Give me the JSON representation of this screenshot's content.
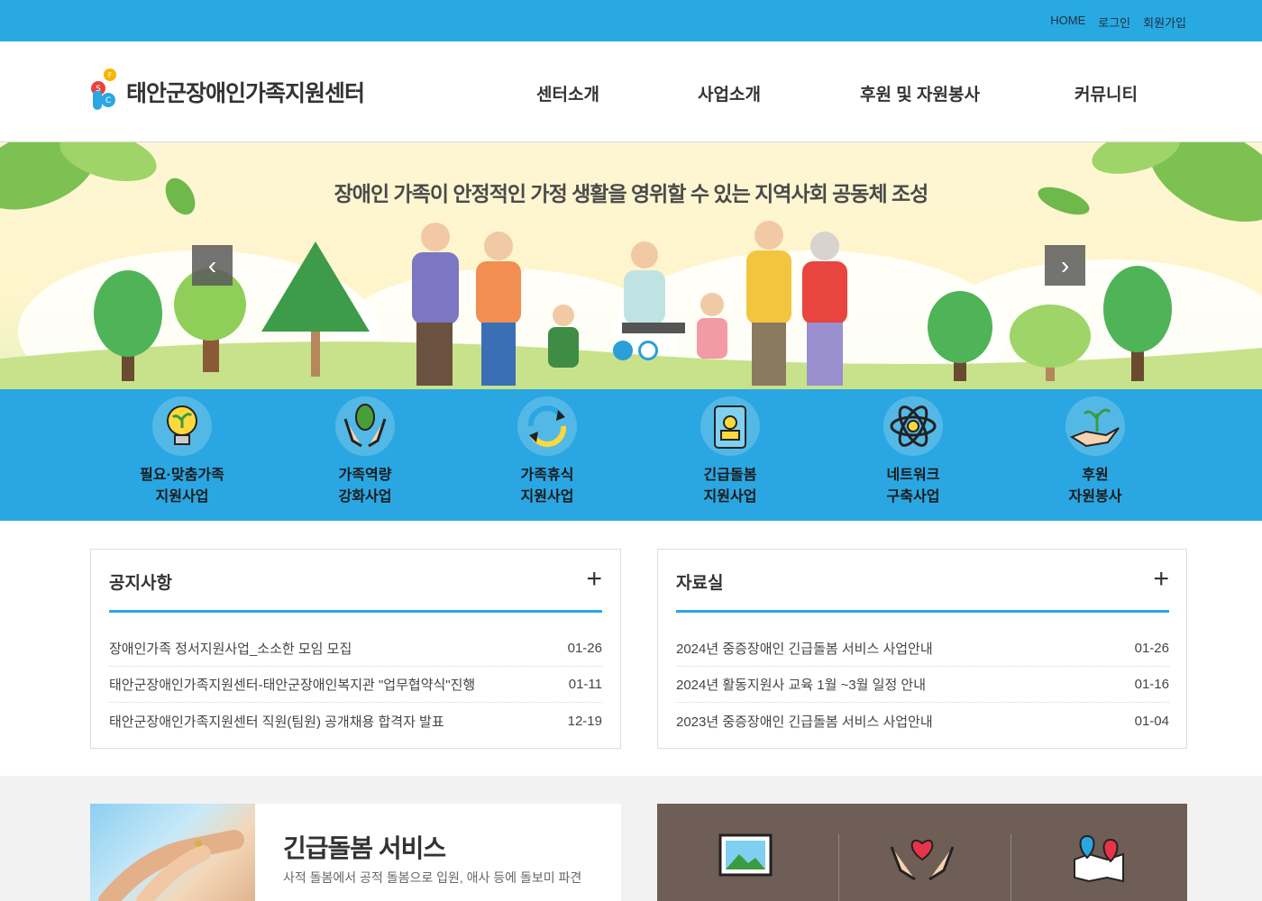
{
  "top_links": [
    "HOME",
    "로그인",
    "회원가입"
  ],
  "site": {
    "name": "태안군장애인가족지원센터"
  },
  "nav": [
    "센터소개",
    "사업소개",
    "후원 및 자원봉사",
    "커뮤니티"
  ],
  "hero": {
    "title": "장애인 가족이 안정적인 가정 생활을 영위할 수 있는 지역사회 공동체 조성"
  },
  "quick_services": [
    {
      "line1": "필요·맞춤가족",
      "line2": "지원사업",
      "icon": "lightbulb-sprout-icon"
    },
    {
      "line1": "가족역량",
      "line2": "강화사업",
      "icon": "hands-leaf-icon"
    },
    {
      "line1": "가족휴식",
      "line2": "지원사업",
      "icon": "refresh-arrows-icon"
    },
    {
      "line1": "긴급돌봄",
      "line2": "지원사업",
      "icon": "id-badge-icon"
    },
    {
      "line1": "네트워크",
      "line2": "구축사업",
      "icon": "atom-network-icon"
    },
    {
      "line1": "후원",
      "line2": "자원봉사",
      "icon": "hand-plant-icon"
    }
  ],
  "notice": {
    "title": "공지사항",
    "items": [
      {
        "text": "장애인가족 정서지원사업_소소한 모임 모집",
        "date": "01-26"
      },
      {
        "text": "태안군장애인가족지원센터-태안군장애인복지관 \"업무협약식\"진행",
        "date": "01-11"
      },
      {
        "text": "태안군장애인가족지원센터 직원(팀원) 공개채용 합격자 발표",
        "date": "12-19"
      }
    ]
  },
  "archive": {
    "title": "자료실",
    "items": [
      {
        "text": "2024년 중증장애인 긴급돌봄 서비스 사업안내",
        "date": "01-26"
      },
      {
        "text": "2024년 활동지원사 교육 1월 ~3월 일정 안내",
        "date": "01-16"
      },
      {
        "text": "2023년 중증장애인 긴급돌봄 서비스 사업안내",
        "date": "01-04"
      }
    ]
  },
  "care_banner": {
    "title": "긴급돌봄 서비스",
    "subtitle": "사적 돌봄에서 공적 돌봄으로 입원, 애사 등에 돌보미 파견"
  },
  "bottom_icons": [
    "photo-gallery-icon",
    "heart-hands-icon",
    "map-location-icon"
  ],
  "colors": {
    "primary": "#29a9e1",
    "panel": "#6f5e55"
  }
}
